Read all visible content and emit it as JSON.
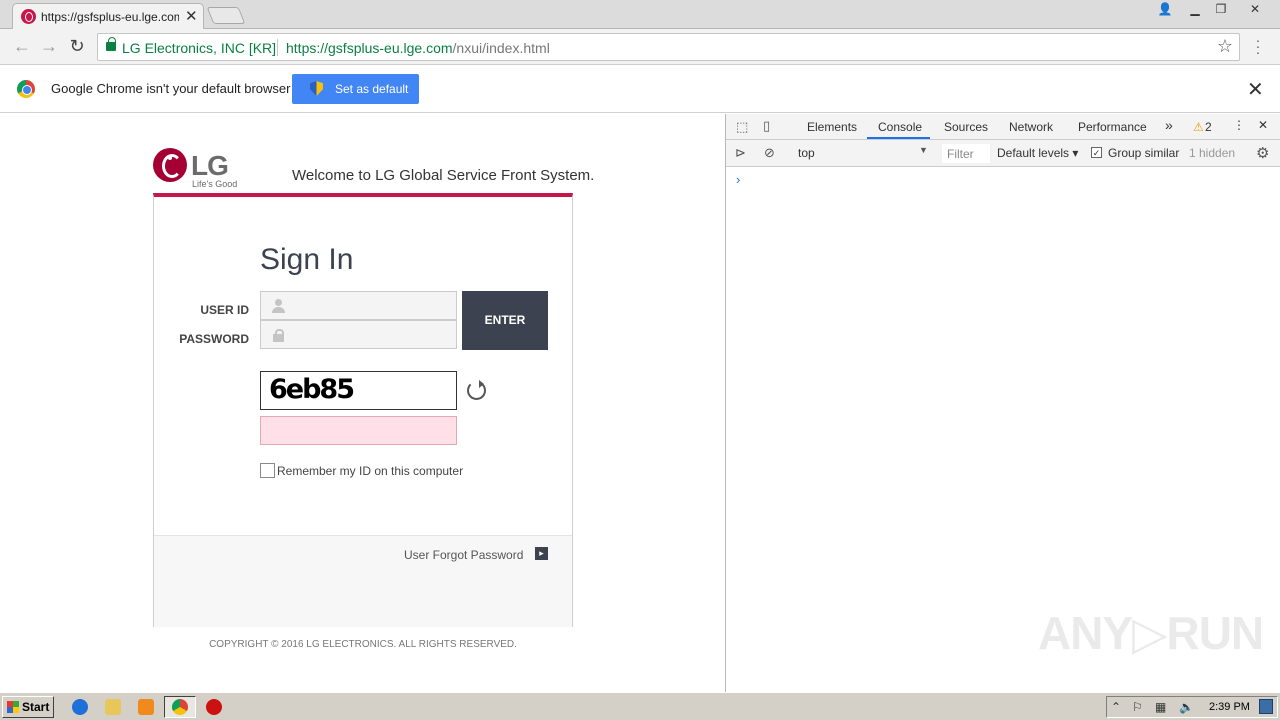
{
  "browser": {
    "tab_title": "https://gsfsplus-eu.lge.com",
    "tab_close_glyph": "✕",
    "site_identity": "LG Electronics, INC [KR]",
    "url_scheme_host": "https://gsfsplus-eu.lge.com",
    "url_path": "/nxui/index.html"
  },
  "infobar": {
    "message": "Google Chrome isn't your default browser",
    "button_label": "Set as default",
    "close_glyph": "✕"
  },
  "page": {
    "logo_text": "LG",
    "slogan": "Life's Good",
    "welcome": "Welcome to LG Global Service Front System.",
    "title": "Sign In",
    "user_id_label": "USER ID",
    "password_label": "PASSWORD",
    "enter_label": "ENTER",
    "captcha_text": "6eb85",
    "remember_label": "Remember my ID on this computer",
    "forgot_label": "User Forgot Password",
    "forgot_arrow": "▸",
    "copyright": "COPYRIGHT © 2016 LG ELECTRONICS. ALL RIGHTS RESERVED."
  },
  "devtools": {
    "tabs": [
      "Elements",
      "Console",
      "Sources",
      "Network",
      "Performance"
    ],
    "active_tab": "Console",
    "more_tabs_glyph": "»",
    "warning_count": "2",
    "context": "top",
    "filter_placeholder": "Filter",
    "levels": "Default levels ▾",
    "group_similar": "Group similar",
    "hidden": "1 hidden",
    "prompt": "›"
  },
  "watermark": "ANY▷RUN",
  "taskbar": {
    "start_label": "Start",
    "clock": "2:39 PM"
  },
  "colors": {
    "lg_red": "#a50034",
    "accent": "#c5174b",
    "button_dark": "#3c4250",
    "chrome_blue": "#4285f4",
    "secure_green": "#0b8043"
  }
}
